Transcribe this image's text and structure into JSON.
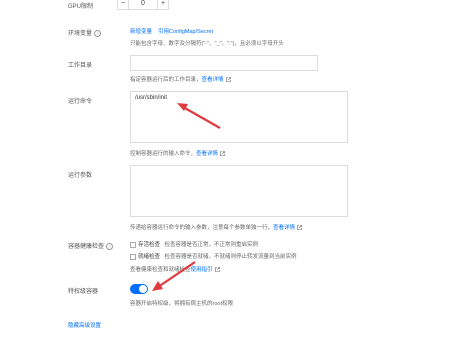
{
  "gpu": {
    "label": "GPU限制",
    "value": "0"
  },
  "env": {
    "label": "环境变量",
    "add_link": "新增变量",
    "ref_link": "引用ConfigMap/Secret",
    "hint": "只能包含字母、数字及分隔符(\"-\"、\"_\"、\".\")，且必须以字母开头"
  },
  "workdir": {
    "label": "工作目录",
    "value": "",
    "hint": "指定容器运行后的工作目录，",
    "link": "查看详情"
  },
  "command": {
    "label": "运行命令",
    "value": "/usr/sbin/init",
    "hint": "控制容器运行的输入命令，",
    "link": "查看详情"
  },
  "args": {
    "label": "运行参数",
    "value": "",
    "hint": "传递给容器运行命令的输入参数，注意每个参数单独一行，",
    "link": "查看详情"
  },
  "health": {
    "label": "容器健康检查",
    "liveness": "存活检查",
    "liveness_desc": "检查容器是否正常，不正常则重启实例",
    "readiness": "就绪检查",
    "readiness_desc": "检查容器是否就绪，不就绪则停止转发流量到当前实例",
    "footer": "查看健康检查和就绪检查",
    "footer_link": "使用指引"
  },
  "privileged": {
    "label": "特权级容器",
    "enabled": true,
    "hint": "容器开启特权级，将拥有宿主机的root权限"
  },
  "advanced_link": "隐藏高级设置",
  "colors": {
    "accent": "#006eff",
    "arrow": "#e0393e"
  }
}
